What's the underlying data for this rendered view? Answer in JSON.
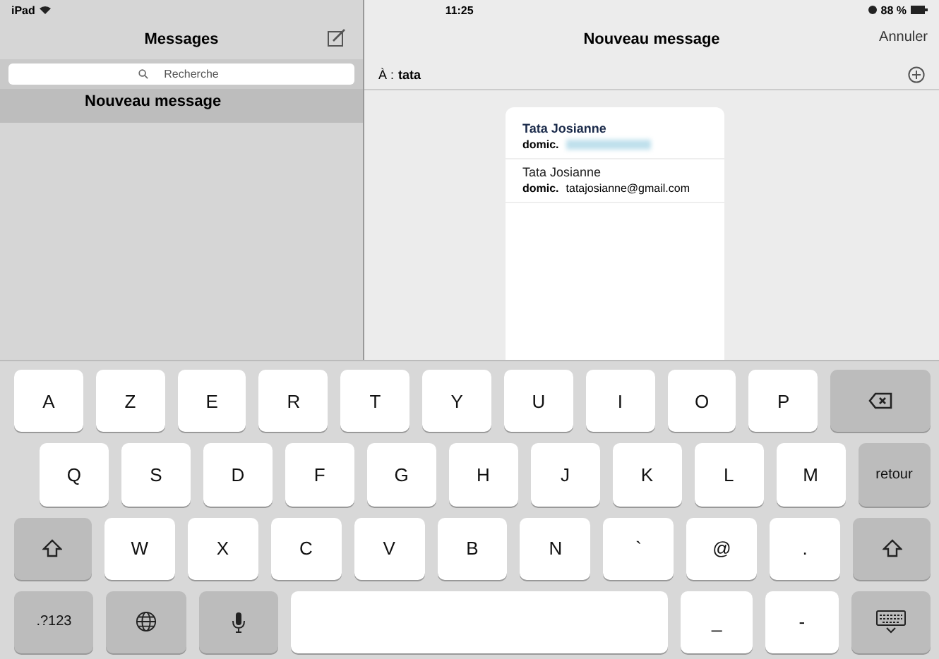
{
  "status_bar": {
    "device": "iPad",
    "time": "11:25",
    "battery": "88 %"
  },
  "sidebar": {
    "title": "Messages",
    "search": {
      "placeholder": "Recherche"
    },
    "conversations": [
      {
        "title": "Nouveau message",
        "selected": true
      }
    ]
  },
  "compose": {
    "title": "Nouveau message",
    "cancel": "Annuler",
    "to_label": "À :",
    "to_value": "tata"
  },
  "suggestions": [
    {
      "name": "Tata Josianne",
      "label": "domic.",
      "redacted": true,
      "selected": true
    },
    {
      "name": "Tata Josianne",
      "label": "domic.",
      "address": "tatajosianne@gmail.com",
      "redacted": false,
      "selected": false
    }
  ],
  "keyboard": {
    "rows": [
      [
        {
          "kind": "letter",
          "label": "A"
        },
        {
          "kind": "letter",
          "label": "Z"
        },
        {
          "kind": "letter",
          "label": "E"
        },
        {
          "kind": "letter",
          "label": "R"
        },
        {
          "kind": "letter",
          "label": "T"
        },
        {
          "kind": "letter",
          "label": "Y"
        },
        {
          "kind": "letter",
          "label": "U"
        },
        {
          "kind": "letter",
          "label": "I"
        },
        {
          "kind": "letter",
          "label": "O"
        },
        {
          "kind": "letter",
          "label": "P"
        },
        {
          "kind": "backspace"
        }
      ],
      [
        {
          "kind": "letter",
          "label": "Q"
        },
        {
          "kind": "letter",
          "label": "S"
        },
        {
          "kind": "letter",
          "label": "D"
        },
        {
          "kind": "letter",
          "label": "F"
        },
        {
          "kind": "letter",
          "label": "G"
        },
        {
          "kind": "letter",
          "label": "H"
        },
        {
          "kind": "letter",
          "label": "J"
        },
        {
          "kind": "letter",
          "label": "K"
        },
        {
          "kind": "letter",
          "label": "L"
        },
        {
          "kind": "letter",
          "label": "M"
        },
        {
          "kind": "return",
          "label": "retour"
        }
      ],
      [
        {
          "kind": "shift"
        },
        {
          "kind": "letter",
          "label": "W"
        },
        {
          "kind": "letter",
          "label": "X"
        },
        {
          "kind": "letter",
          "label": "C"
        },
        {
          "kind": "letter",
          "label": "V"
        },
        {
          "kind": "letter",
          "label": "B"
        },
        {
          "kind": "letter",
          "label": "N"
        },
        {
          "kind": "letter",
          "label": "`"
        },
        {
          "kind": "letter",
          "label": "@"
        },
        {
          "kind": "letter",
          "label": "."
        },
        {
          "kind": "shift"
        }
      ],
      [
        {
          "kind": "numbers",
          "label": ".?123"
        },
        {
          "kind": "globe"
        },
        {
          "kind": "mic"
        },
        {
          "kind": "space"
        },
        {
          "kind": "letter",
          "label": "_"
        },
        {
          "kind": "letter",
          "label": "-"
        },
        {
          "kind": "hide"
        }
      ]
    ]
  }
}
